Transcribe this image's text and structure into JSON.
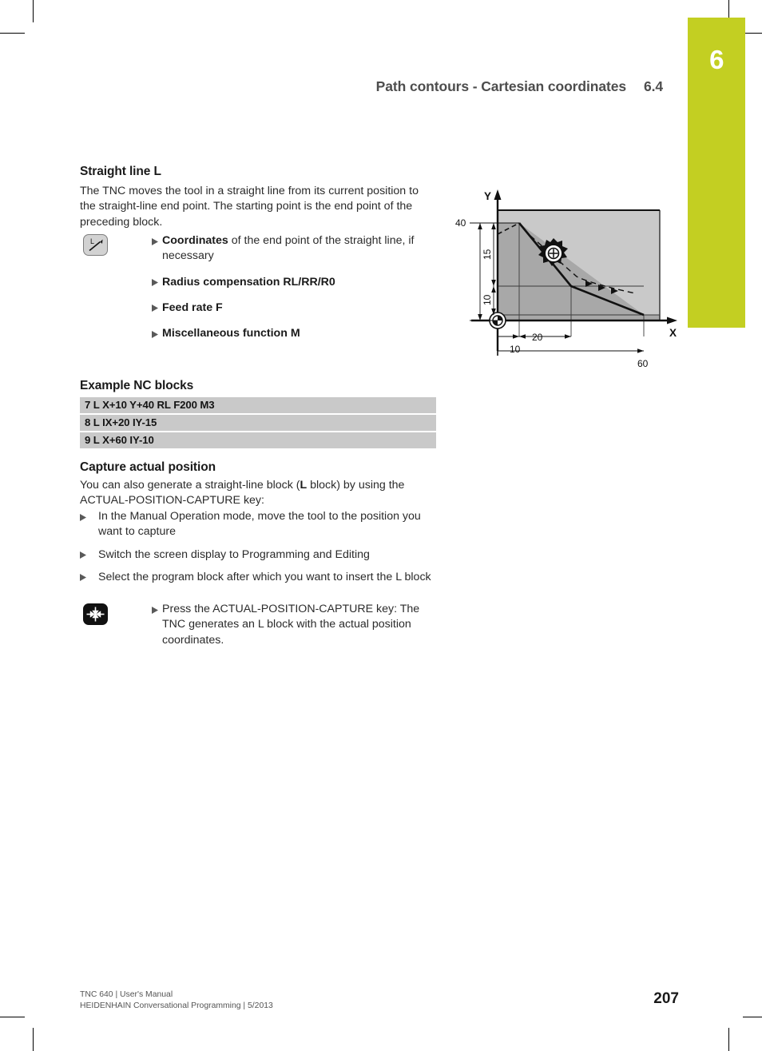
{
  "page": {
    "chapter_number": "6",
    "accent_color": "#c3cf22",
    "page_number": "207"
  },
  "header": {
    "title": "Path contours - Cartesian coordinates",
    "section": "6.4"
  },
  "main": {
    "section_title": "Straight line L",
    "intro": "The TNC moves the tool in a straight line from its current position to the straight-line end point. The starting point is the end point of the preceding block.",
    "param_icon_name": "straight-line-L-key",
    "parameters": [
      {
        "bold": "Coordinates",
        "rest": " of the end point of the straight line, if necessary",
        "all_bold": false
      },
      {
        "bold": "Radius compensation RL/RR/R0",
        "rest": "",
        "all_bold": true
      },
      {
        "bold": "Feed rate F",
        "rest": "",
        "all_bold": true
      },
      {
        "bold": "Miscellaneous function M",
        "rest": "",
        "all_bold": true
      }
    ],
    "nc_heading": "Example NC blocks",
    "nc_blocks": [
      "7 L X+10 Y+40 RL F200 M3",
      "8 L IX+20 IY-15",
      "9 L X+60 IY-10"
    ],
    "capture_heading": "Capture actual position",
    "capture_intro_1": "You can also generate a straight-line block (",
    "capture_intro_bold": "L",
    "capture_intro_2": " block) by using the ACTUAL-POSITION-CAPTURE key:",
    "capture_steps": [
      "In the Manual Operation mode, move the tool to the position you want to capture",
      "Switch the screen display to Programming and Editing",
      "Select the program block after which you want to insert the L block"
    ],
    "capture_key_icon_name": "actual-position-capture-key",
    "capture_final_step": "Press the ACTUAL-POSITION-CAPTURE key: The TNC generates an L block with the actual position coordinates."
  },
  "figure": {
    "name": "straight-line-contour-diagram",
    "axis_x_label": "X",
    "axis_y_label": "Y",
    "dimensions": {
      "y_total": "40",
      "y_upper": "15",
      "y_lower": "10",
      "x_first": "10",
      "x_step": "20",
      "x_total": "60"
    },
    "datum_symbol": "workpiece-datum",
    "tool_symbol": "milling-cutter"
  },
  "footer": {
    "line1": "TNC 640 | User's Manual",
    "line2": "HEIDENHAIN Conversational Programming | 5/2013"
  }
}
